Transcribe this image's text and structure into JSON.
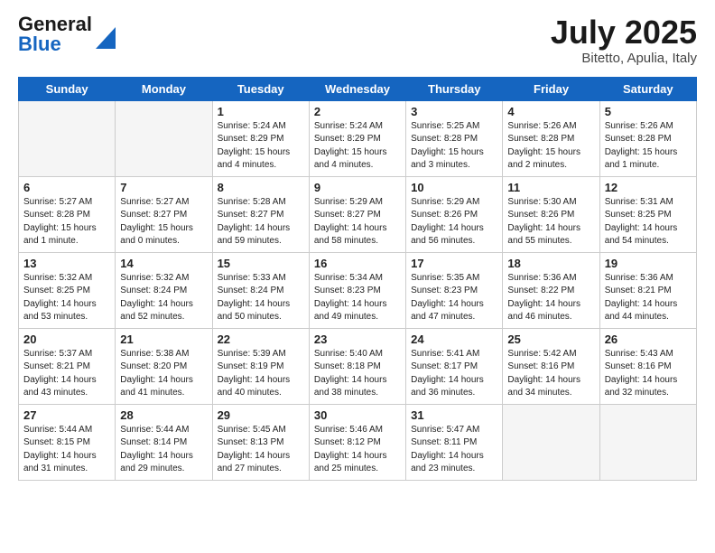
{
  "header": {
    "logo_general": "General",
    "logo_blue": "Blue",
    "month_title": "July 2025",
    "location": "Bitetto, Apulia, Italy"
  },
  "weekdays": [
    "Sunday",
    "Monday",
    "Tuesday",
    "Wednesday",
    "Thursday",
    "Friday",
    "Saturday"
  ],
  "weeks": [
    [
      {
        "day": "",
        "text": ""
      },
      {
        "day": "",
        "text": ""
      },
      {
        "day": "1",
        "text": "Sunrise: 5:24 AM\nSunset: 8:29 PM\nDaylight: 15 hours\nand 4 minutes."
      },
      {
        "day": "2",
        "text": "Sunrise: 5:24 AM\nSunset: 8:29 PM\nDaylight: 15 hours\nand 4 minutes."
      },
      {
        "day": "3",
        "text": "Sunrise: 5:25 AM\nSunset: 8:28 PM\nDaylight: 15 hours\nand 3 minutes."
      },
      {
        "day": "4",
        "text": "Sunrise: 5:26 AM\nSunset: 8:28 PM\nDaylight: 15 hours\nand 2 minutes."
      },
      {
        "day": "5",
        "text": "Sunrise: 5:26 AM\nSunset: 8:28 PM\nDaylight: 15 hours\nand 1 minute."
      }
    ],
    [
      {
        "day": "6",
        "text": "Sunrise: 5:27 AM\nSunset: 8:28 PM\nDaylight: 15 hours\nand 1 minute."
      },
      {
        "day": "7",
        "text": "Sunrise: 5:27 AM\nSunset: 8:27 PM\nDaylight: 15 hours\nand 0 minutes."
      },
      {
        "day": "8",
        "text": "Sunrise: 5:28 AM\nSunset: 8:27 PM\nDaylight: 14 hours\nand 59 minutes."
      },
      {
        "day": "9",
        "text": "Sunrise: 5:29 AM\nSunset: 8:27 PM\nDaylight: 14 hours\nand 58 minutes."
      },
      {
        "day": "10",
        "text": "Sunrise: 5:29 AM\nSunset: 8:26 PM\nDaylight: 14 hours\nand 56 minutes."
      },
      {
        "day": "11",
        "text": "Sunrise: 5:30 AM\nSunset: 8:26 PM\nDaylight: 14 hours\nand 55 minutes."
      },
      {
        "day": "12",
        "text": "Sunrise: 5:31 AM\nSunset: 8:25 PM\nDaylight: 14 hours\nand 54 minutes."
      }
    ],
    [
      {
        "day": "13",
        "text": "Sunrise: 5:32 AM\nSunset: 8:25 PM\nDaylight: 14 hours\nand 53 minutes."
      },
      {
        "day": "14",
        "text": "Sunrise: 5:32 AM\nSunset: 8:24 PM\nDaylight: 14 hours\nand 52 minutes."
      },
      {
        "day": "15",
        "text": "Sunrise: 5:33 AM\nSunset: 8:24 PM\nDaylight: 14 hours\nand 50 minutes."
      },
      {
        "day": "16",
        "text": "Sunrise: 5:34 AM\nSunset: 8:23 PM\nDaylight: 14 hours\nand 49 minutes."
      },
      {
        "day": "17",
        "text": "Sunrise: 5:35 AM\nSunset: 8:23 PM\nDaylight: 14 hours\nand 47 minutes."
      },
      {
        "day": "18",
        "text": "Sunrise: 5:36 AM\nSunset: 8:22 PM\nDaylight: 14 hours\nand 46 minutes."
      },
      {
        "day": "19",
        "text": "Sunrise: 5:36 AM\nSunset: 8:21 PM\nDaylight: 14 hours\nand 44 minutes."
      }
    ],
    [
      {
        "day": "20",
        "text": "Sunrise: 5:37 AM\nSunset: 8:21 PM\nDaylight: 14 hours\nand 43 minutes."
      },
      {
        "day": "21",
        "text": "Sunrise: 5:38 AM\nSunset: 8:20 PM\nDaylight: 14 hours\nand 41 minutes."
      },
      {
        "day": "22",
        "text": "Sunrise: 5:39 AM\nSunset: 8:19 PM\nDaylight: 14 hours\nand 40 minutes."
      },
      {
        "day": "23",
        "text": "Sunrise: 5:40 AM\nSunset: 8:18 PM\nDaylight: 14 hours\nand 38 minutes."
      },
      {
        "day": "24",
        "text": "Sunrise: 5:41 AM\nSunset: 8:17 PM\nDaylight: 14 hours\nand 36 minutes."
      },
      {
        "day": "25",
        "text": "Sunrise: 5:42 AM\nSunset: 8:16 PM\nDaylight: 14 hours\nand 34 minutes."
      },
      {
        "day": "26",
        "text": "Sunrise: 5:43 AM\nSunset: 8:16 PM\nDaylight: 14 hours\nand 32 minutes."
      }
    ],
    [
      {
        "day": "27",
        "text": "Sunrise: 5:44 AM\nSunset: 8:15 PM\nDaylight: 14 hours\nand 31 minutes."
      },
      {
        "day": "28",
        "text": "Sunrise: 5:44 AM\nSunset: 8:14 PM\nDaylight: 14 hours\nand 29 minutes."
      },
      {
        "day": "29",
        "text": "Sunrise: 5:45 AM\nSunset: 8:13 PM\nDaylight: 14 hours\nand 27 minutes."
      },
      {
        "day": "30",
        "text": "Sunrise: 5:46 AM\nSunset: 8:12 PM\nDaylight: 14 hours\nand 25 minutes."
      },
      {
        "day": "31",
        "text": "Sunrise: 5:47 AM\nSunset: 8:11 PM\nDaylight: 14 hours\nand 23 minutes."
      },
      {
        "day": "",
        "text": ""
      },
      {
        "day": "",
        "text": ""
      }
    ]
  ]
}
